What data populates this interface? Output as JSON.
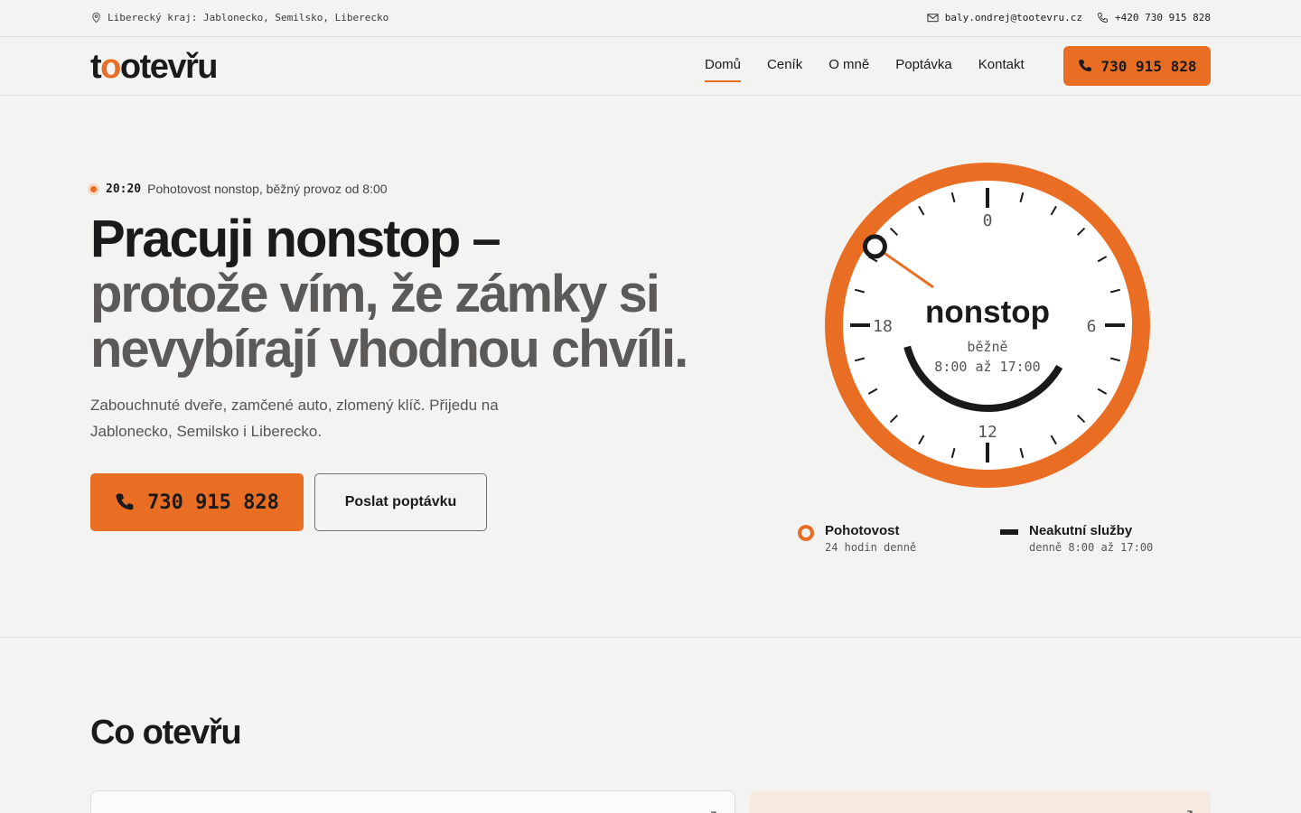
{
  "topbar": {
    "location": "Liberecký kraj: Jablonecko, Semilsko, Liberecko",
    "email": "baly.ondrej@tootevru.cz",
    "phone": "+420 730 915 828"
  },
  "header": {
    "logo": "tootevřu",
    "nav": [
      {
        "label": "Domů",
        "active": true
      },
      {
        "label": "Ceník"
      },
      {
        "label": "O mně"
      },
      {
        "label": "Poptávka"
      },
      {
        "label": "Kontakt"
      }
    ],
    "call_label": "730 915 828"
  },
  "hero": {
    "status_time": "20:20",
    "status_text": "Pohotovost nonstop, běžný provoz od 8:00",
    "title_line1": "Pracuji nonstop –",
    "title_line2": "protože vím, že zámky si nevybírají vhodnou chvíli.",
    "lead": "Zabouchnuté dveře, zamčené auto, zlomený klíč. Přijedu na Jablonecko, Semilsko i Liberecko.",
    "cta_call": "730 915 828",
    "cta_form": "Poslat poptávku"
  },
  "clock": {
    "center_title": "nonstop",
    "center_sub1": "běžně",
    "center_sub2": "8:00 až 17:00",
    "labels": {
      "top": "0",
      "right": "6",
      "bottom": "12",
      "left": "18"
    },
    "current_time_hours": 20.33,
    "regular_hours": {
      "start": 8,
      "end": 17
    },
    "accent_color": "#e96e24",
    "dark_color": "#1a1a1a"
  },
  "legend": [
    {
      "title": "Pohotovost",
      "sub": "24 hodin denně",
      "icon": "ring-icon"
    },
    {
      "title": "Neakutní služby",
      "sub": "denně 8:00 až 17:00",
      "icon": "bar-icon"
    }
  ],
  "section": {
    "title": "Co otevřu"
  }
}
